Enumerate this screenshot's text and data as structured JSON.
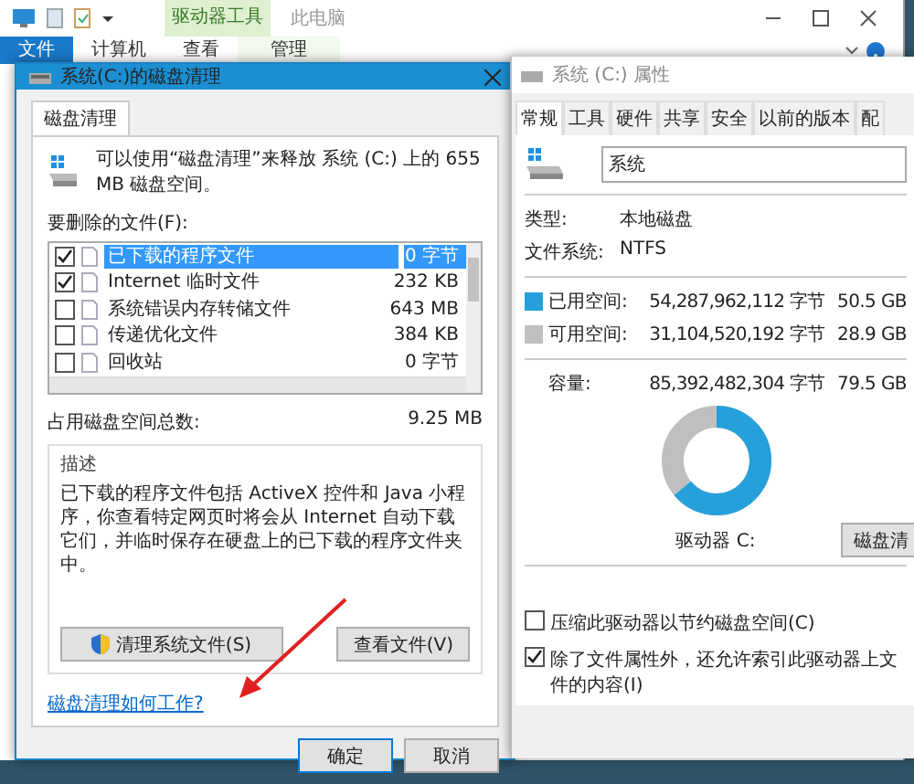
{
  "explorer": {
    "context_label": "驱动器工具",
    "title": "此电脑",
    "tabs": [
      {
        "label": "文件",
        "selected": true
      },
      {
        "label": "计算机",
        "selected": false
      },
      {
        "label": "查看",
        "selected": false
      },
      {
        "label": "管理",
        "selected": false
      }
    ]
  },
  "cleanup_dialog": {
    "title": "系统(C:)的磁盘清理",
    "tab": "磁盘清理",
    "intro": "可以使用“磁盘清理”来释放 系统 (C:) 上的 655 MB 磁盘空间。",
    "files_label": "要删除的文件(F):",
    "files": [
      {
        "name": "已下载的程序文件",
        "size": "0 字节",
        "checked": true,
        "selected": true
      },
      {
        "name": "Internet 临时文件",
        "size": "232 KB",
        "checked": true,
        "selected": false
      },
      {
        "name": "系统错误内存转储文件",
        "size": "643 MB",
        "checked": false,
        "selected": false
      },
      {
        "name": "传递优化文件",
        "size": "384 KB",
        "checked": false,
        "selected": false
      },
      {
        "name": "回收站",
        "size": "0 字节",
        "checked": false,
        "selected": false
      }
    ],
    "total_label": "占用磁盘空间总数:",
    "total_value": "9.25 MB",
    "description_label": "描述",
    "description": "已下载的程序文件包括 ActiveX 控件和 Java 小程序，你查看特定网页时将会从 Internet 自动下载它们，并临时保存在硬盘上的已下载的程序文件夹中。",
    "clean_system_button": "清理系统文件(S)",
    "view_files_button": "查看文件(V)",
    "help_link": "磁盘清理如何工作?",
    "ok_button": "确定",
    "cancel_button": "取消"
  },
  "properties_dialog": {
    "title": "系统 (C:) 属性",
    "tabs": [
      {
        "label": "常规",
        "selected": true
      },
      {
        "label": "工具",
        "selected": false
      },
      {
        "label": "硬件",
        "selected": false
      },
      {
        "label": "共享",
        "selected": false
      },
      {
        "label": "安全",
        "selected": false
      },
      {
        "label": "以前的版本",
        "selected": false
      },
      {
        "label": "配",
        "selected": false
      }
    ],
    "name_value": "系统",
    "type_label": "类型:",
    "type_value": "本地磁盘",
    "fs_label": "文件系统:",
    "fs_value": "NTFS",
    "spaces": [
      {
        "label": "已用空间:",
        "bytes": "54,287,962,112 字节",
        "size": "50.5 GB",
        "color": "#26a0da"
      },
      {
        "label": "可用空间:",
        "bytes": "31,104,520,192 字节",
        "size": "28.9 GB",
        "color": "#bfbfbf"
      }
    ],
    "capacity": {
      "label": "容量:",
      "bytes": "85,392,482,304 字节",
      "size": "79.5 GB"
    },
    "usage": {
      "level": 0.64
    },
    "drive_label": "驱动器 C:",
    "cleanup_button": "磁盘清",
    "options": [
      {
        "label": "压缩此驱动器以节约磁盘空间(C)",
        "checked": false
      },
      {
        "label": "除了文件属性外，还允许索引此驱动器上文件的内容(I)",
        "checked": true
      }
    ]
  }
}
